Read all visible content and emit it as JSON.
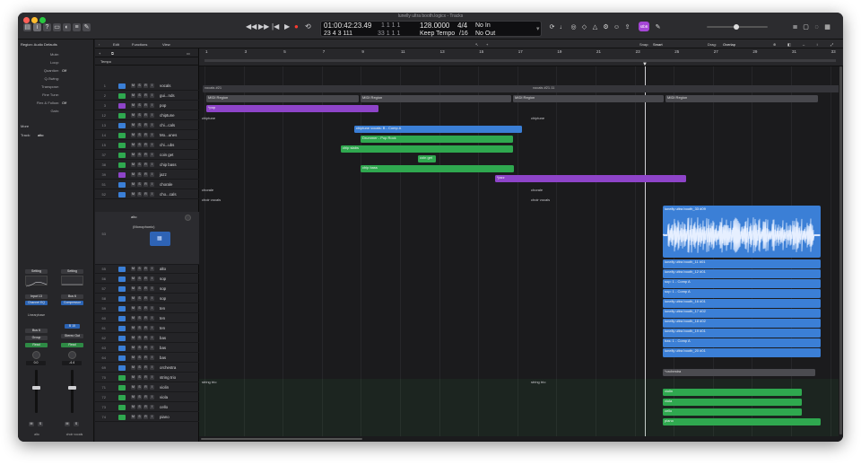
{
  "window": {
    "title": "lunelly ultra booth.logicx - Tracks"
  },
  "transport": {
    "position_time": "01:00:42:23.49",
    "position_bars": "23  4  3  111",
    "left_locator": "1  1  1     1",
    "right_locator": "33  1  1     1",
    "tempo": "128.0000",
    "tempo_mode": "Keep Tempo",
    "signature": "4/4",
    "division": "/16",
    "midi_in": "No In",
    "midi_out": "No Out"
  },
  "toolbar": {
    "edit": "Edit",
    "functions": "Functions",
    "view": "View",
    "snap_label": "Snap:",
    "snap_value": "Smart",
    "drag_label": "Drag:",
    "drag_value": "Overlap",
    "badge": "stb6"
  },
  "inspector": {
    "region_header": "Region: Audio Defaults",
    "rows": [
      {
        "label": "Mute:",
        "value": ""
      },
      {
        "label": "Loop:",
        "value": ""
      },
      {
        "label": "Quantize:",
        "value": "Off"
      },
      {
        "label": "Q-Swing:",
        "value": ""
      },
      {
        "label": "Transpose:",
        "value": ""
      },
      {
        "label": "Fine Tune:",
        "value": ""
      },
      {
        "label": "Flex & Follow:",
        "value": "Off"
      },
      {
        "label": "Gain:",
        "value": ""
      }
    ],
    "more": "More",
    "track_label": "Track:",
    "track_name": "alto",
    "channel_strips": [
      {
        "setting": "Setting",
        "eq": "EQ",
        "input": "Input 13",
        "plugin": "Channel EQ",
        "sends": "Sends",
        "output": "Bus 6",
        "group": "Group",
        "automation": "Read",
        "pan": "0.0",
        "name": "alto",
        "mute": "M",
        "solo": "S"
      },
      {
        "setting": "Setting",
        "eq": "EQ",
        "input": "Bus 6",
        "plugin": "Compressor",
        "sends": "",
        "output": "Stereo Out",
        "group": "",
        "automation": "Read",
        "pan": "-4.4",
        "name": "choir vocals",
        "mute": "M",
        "solo": "S"
      }
    ],
    "linear_phase": "Linearphase",
    "badge_value": "B 15"
  },
  "track_list": {
    "tempo_label": "Tempo",
    "tracks": [
      {
        "num": "1",
        "name": "vocals",
        "color": "#3b7fd6"
      },
      {
        "num": "2",
        "name": "gui...nds",
        "color": "#2fa84f"
      },
      {
        "num": "3",
        "name": "pop",
        "color": "#8e44c9"
      },
      {
        "num": "12",
        "name": "chiptune",
        "color": "#2fa84f"
      },
      {
        "num": "13",
        "name": "chi...cals",
        "color": "#3b7fd6"
      },
      {
        "num": "14",
        "name": "Mo...unes",
        "color": "#2fa84f"
      },
      {
        "num": "15",
        "name": "chi...ubs",
        "color": "#2fa84f"
      },
      {
        "num": "37",
        "name": "coin get",
        "color": "#2fa84f"
      },
      {
        "num": "38",
        "name": "chip bass",
        "color": "#2fa84f"
      },
      {
        "num": "39",
        "name": "jazz",
        "color": "#8e44c9"
      },
      {
        "num": "51",
        "name": "chorale",
        "color": "#3b7fd6"
      },
      {
        "num": "52",
        "name": "cho...cals",
        "color": "#3b7fd6"
      },
      {
        "num": "54",
        "name": "alto",
        "color": "#3b7fd6"
      },
      {
        "num": "55",
        "name": "alto",
        "color": "#3b7fd6"
      },
      {
        "num": "56",
        "name": "sop",
        "color": "#3b7fd6"
      },
      {
        "num": "57",
        "name": "sop",
        "color": "#3b7fd6"
      },
      {
        "num": "58",
        "name": "sop",
        "color": "#3b7fd6"
      },
      {
        "num": "59",
        "name": "ten",
        "color": "#3b7fd6"
      },
      {
        "num": "60",
        "name": "ten",
        "color": "#3b7fd6"
      },
      {
        "num": "61",
        "name": "ten",
        "color": "#3b7fd6"
      },
      {
        "num": "62",
        "name": "bas",
        "color": "#3b7fd6"
      },
      {
        "num": "63",
        "name": "bas",
        "color": "#3b7fd6"
      },
      {
        "num": "64",
        "name": "bas",
        "color": "#3b7fd6"
      },
      {
        "num": "69",
        "name": "orchestra",
        "color": "#3b7fd6"
      },
      {
        "num": "70",
        "name": "string trio",
        "color": "#2fa84f"
      },
      {
        "num": "71",
        "name": "violin",
        "color": "#2fa84f"
      },
      {
        "num": "72",
        "name": "viola",
        "color": "#2fa84f"
      },
      {
        "num": "73",
        "name": "cello",
        "color": "#2fa84f"
      },
      {
        "num": "74",
        "name": "piano",
        "color": "#2fa84f"
      }
    ],
    "expanded_track": {
      "num": "53",
      "name": "alto",
      "sub": "(Monophonic)"
    }
  },
  "ruler": {
    "bars": [
      "1",
      "3",
      "5",
      "7",
      "9",
      "11",
      "13",
      "15",
      "17",
      "19",
      "21",
      "23",
      "25",
      "27",
      "29",
      "31",
      "33"
    ]
  },
  "regions": {
    "vocals": "vocals #21",
    "vocals2": "vocals #21.11",
    "midi": "MIDI Region",
    "pop": "*pop",
    "chiptune": "chiptune",
    "chiptune2": "chiptune",
    "chip_vocals": "chiptune vocals: B - Comp A",
    "drummer": "Drummer - Pop Rock",
    "chip_stabs": "chip stabs",
    "coin": "coin get",
    "chip_bass": "chip bass",
    "jazz": "*jazz",
    "chorale": "chorale",
    "chorale2": "chorale",
    "choir": "choir vocals",
    "choir2": "choir vocals",
    "booth_main": "lunelly ultra booth_33 #09",
    "booth": [
      "lunelly ultra booth_11 #01",
      "lunelly ultra booth_12 #01",
      "sop: 1 - Comp A",
      "sop: 1 - Comp A",
      "lunelly ultra booth_16 #01",
      "lunelly ultra booth_17 #02",
      "lunelly ultra booth_18 #02",
      "lunelly ultra booth_19 #01",
      "bas: 1 - Comp A",
      "lunelly ultra booth_20 #01"
    ],
    "orchestra": "*orchestra",
    "string_trio": "string trio",
    "string_trio2": "string trio",
    "violin": "violin",
    "viola": "viola",
    "cello": "cello",
    "piano": "piano"
  },
  "colors": {
    "blue": "#3b7fd6",
    "green": "#2fa84f",
    "purple": "#8e44c9",
    "gray": "#4b4b50"
  }
}
